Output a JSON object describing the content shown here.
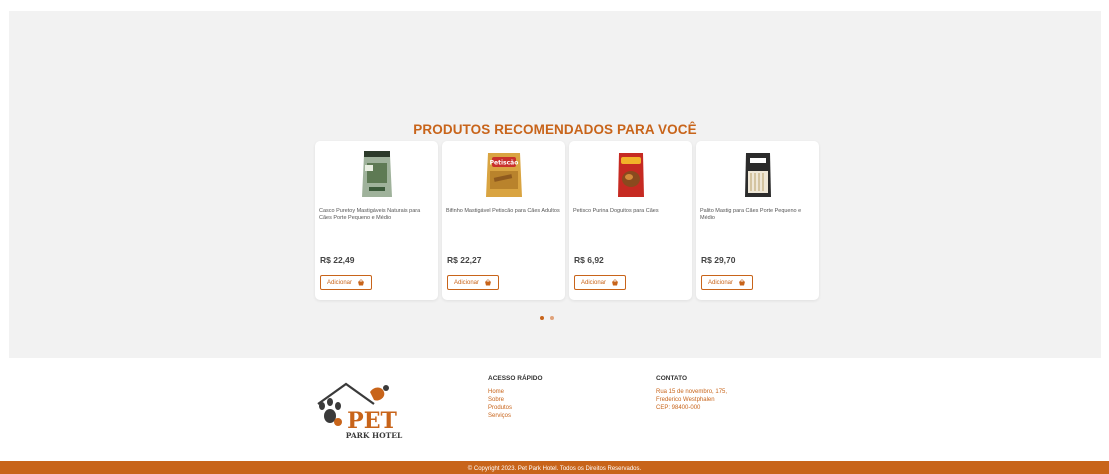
{
  "recommended": {
    "title": "PRODUTOS RECOMENDADOS PARA VOCÊ",
    "products": [
      {
        "name": "Casco Puretoy Mastigáveis Naturais para Cães Porte Pequeno e Médio",
        "price": "R$ 22,49",
        "button": "Adicionar",
        "image": "green-snack-bag"
      },
      {
        "name": "Bifinho Mastigável Petiscão para Cães Adultos",
        "price": "R$ 22,27",
        "button": "Adicionar",
        "image": "petiscao-bag"
      },
      {
        "name": "Petisco Purina Doguitos para Cães",
        "price": "R$ 6,92",
        "button": "Adicionar",
        "image": "doguitos-bag"
      },
      {
        "name": "Palito Mastig para Cães Porte Pequeno e Médio",
        "price": "R$ 29,70",
        "button": "Adicionar",
        "image": "palito-bag"
      }
    ],
    "carousel_pages": 2,
    "active_page": 1
  },
  "footer": {
    "logo": {
      "word": "PET",
      "subtitle": "PARK HOTEL"
    },
    "quick_access": {
      "title": "ACESSO RÁPIDO",
      "links": [
        "Home",
        "Sobre",
        "Produtos",
        "Serviços"
      ]
    },
    "contact": {
      "title": "CONTATO",
      "lines": [
        "Rua 15 de novembro, 175,",
        "Frederico Westphalen",
        "CEP: 98400-000"
      ]
    },
    "copyright": "© Copyright 2023. Pet Park Hotel. Todos os Direitos Reservados."
  },
  "colors": {
    "accent": "#c8641a",
    "section_bg": "#f2f2f2"
  }
}
